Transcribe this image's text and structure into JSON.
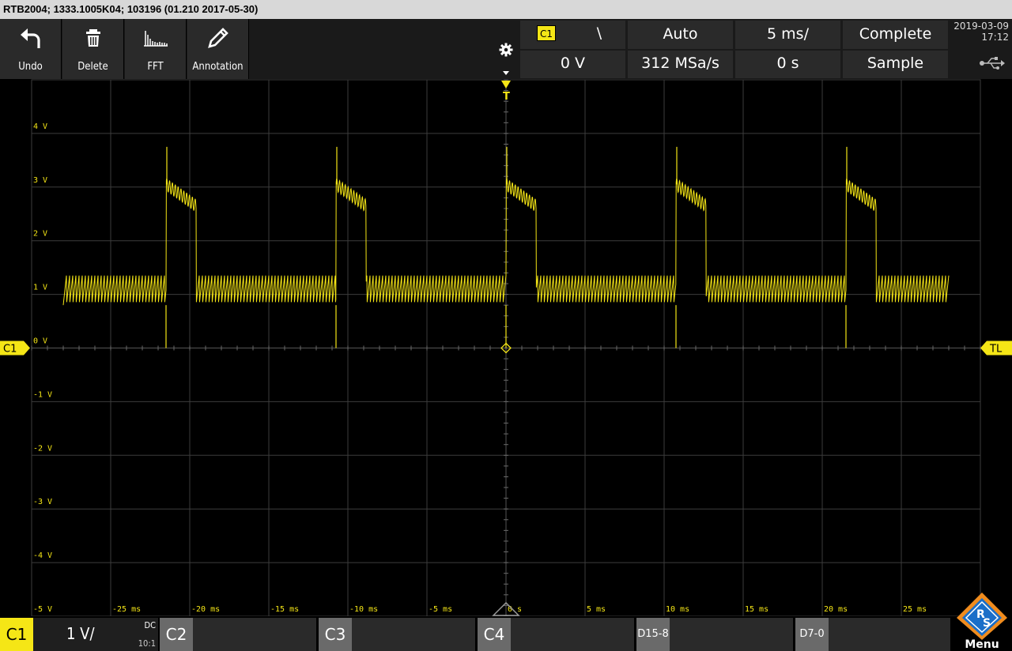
{
  "window_title": "RTB2004; 1333.1005K04; 103196 (01.210 2017-05-30)",
  "toolbar": {
    "undo_label": "Undo",
    "delete_label": "Delete",
    "fft_label": "FFT",
    "annotation_label": "Annotation"
  },
  "trigger": {
    "source": "C1",
    "slope_symbol": "\\",
    "mode": "Auto",
    "level": "0 V"
  },
  "timebase": {
    "scale": "5 ms/",
    "position": "0 s",
    "sample_rate": "312 MSa/s"
  },
  "acquisition": {
    "status": "Complete",
    "mode": "Sample"
  },
  "datetime": {
    "date": "2019-03-09",
    "time": "17:12"
  },
  "markers": {
    "channel_label": "C1",
    "trigger_level_label": "TL",
    "trigger_position_label": "T"
  },
  "colors": {
    "channel1": "#f5e616",
    "grid": "#3c3c3c",
    "ticks": "#6a6a6a",
    "panel": "#2a2a2a"
  },
  "axis": {
    "y_labels": [
      "4 V",
      "3 V",
      "2 V",
      "1 V",
      "0 V",
      "-1 V",
      "-2 V",
      "-3 V",
      "-4 V",
      "-5 V"
    ],
    "x_labels": [
      "-25 ms",
      "-20 ms",
      "-15 ms",
      "-10 ms",
      "-5 ms",
      "0 s",
      "5 ms",
      "10 ms",
      "15 ms",
      "20 ms",
      "25 ms"
    ]
  },
  "chart_data": {
    "type": "line",
    "x_range_ms": [
      -30,
      30
    ],
    "y_range_v": [
      -5,
      5
    ],
    "grid": true,
    "series": [
      {
        "name": "C1",
        "baseline_v": 1.0,
        "ripple_v": [
          0.8,
          1.35
        ],
        "pulse_start_ms": [
          -21.5,
          -10.75,
          0,
          10.75,
          21.5
        ],
        "pulse_width_ms": 1.9,
        "pulse_start_level_v": 3.05,
        "pulse_end_level_v": 2.65,
        "spike_peak_v": 3.75,
        "dip_v": 0
      }
    ]
  },
  "bottom": {
    "ch1": {
      "label": "C1",
      "scale": "1 V/",
      "coupling": "DC",
      "probe": "10:1"
    },
    "ch2_label": "C2",
    "ch3_label": "C3",
    "ch4_label": "C4",
    "logic_high_label": "D15-8",
    "logic_low_label": "D7-0",
    "menu_label": "Menu",
    "logo_text": "R&S"
  }
}
